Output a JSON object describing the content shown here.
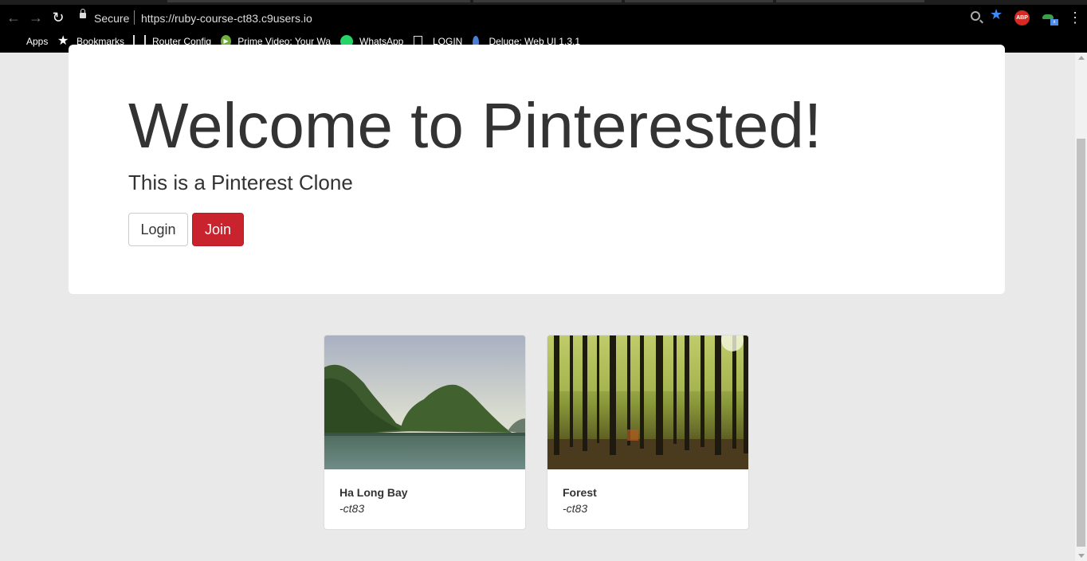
{
  "browser": {
    "secure_label": "Secure",
    "url": "https://ruby-course-ct83.c9users.io",
    "bookmarks": [
      {
        "label": "Apps",
        "icon": "apps-grid-icon"
      },
      {
        "label": "Bookmarks",
        "icon": "star-icon"
      },
      {
        "label": "Router Config",
        "icon": "router-icon"
      },
      {
        "label": "Prime Video: Your Wa",
        "icon": "prime-video-icon"
      },
      {
        "label": "WhatsApp",
        "icon": "whatsapp-icon"
      },
      {
        "label": "LOGIN",
        "icon": "page-icon"
      },
      {
        "label": "Deluge: Web UI 1.3.1",
        "icon": "deluge-icon"
      }
    ],
    "extensions": {
      "abp_label": "ABP",
      "ext_badge": "x"
    },
    "accent": "#3b8cf5"
  },
  "hero": {
    "title": "Welcome to Pinterested!",
    "subtitle": "This is a Pinterest Clone",
    "login_label": "Login",
    "join_label": "Join",
    "join_color": "#c9232d"
  },
  "pins": [
    {
      "title": "Ha Long Bay",
      "author": "-ct83",
      "image": "bay-landscape-image"
    },
    {
      "title": "Forest",
      "author": "-ct83",
      "image": "forest-image"
    }
  ]
}
